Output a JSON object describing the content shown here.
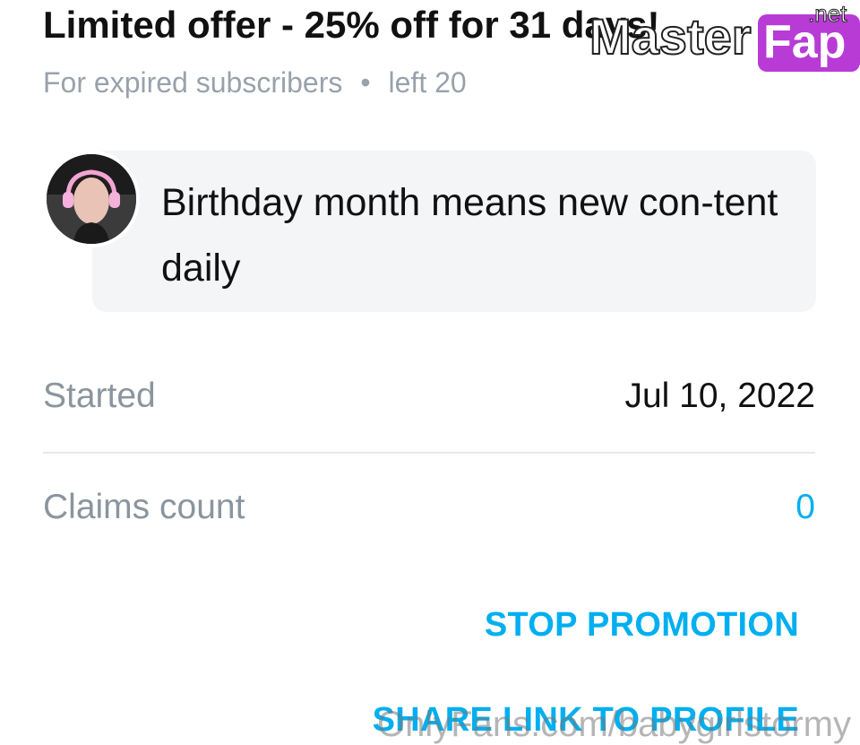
{
  "offer": {
    "title": "Limited offer - 25% off for 31 days!",
    "audience": "For expired subscribers",
    "separator": "•",
    "remaining": "left 20"
  },
  "message": {
    "text": "Birthday month means new con-tent daily",
    "avatar_icon": "profile-photo"
  },
  "details": {
    "started_label": "Started",
    "started_value": "Jul 10, 2022",
    "claims_label": "Claims count",
    "claims_value": "0"
  },
  "actions": {
    "stop_label": "STOP PROMOTION",
    "share_label": "SHARE LINK TO PROFILE"
  },
  "watermarks": {
    "logo_text_1": "Master",
    "logo_text_2": "Fap",
    "logo_suffix": ".net",
    "footer": "OnlyFans.com/babygirlstormy"
  },
  "colors": {
    "accent": "#00aff0",
    "muted": "#8a959e",
    "text": "#111111",
    "bubble": "#f4f5f6"
  }
}
